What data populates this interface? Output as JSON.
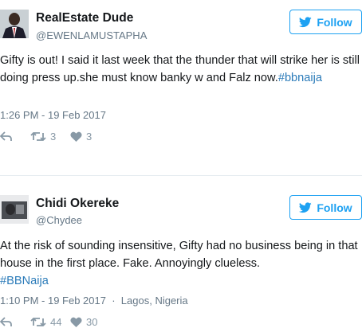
{
  "tweets": [
    {
      "name": "RealEstate Dude",
      "handle": "@EWENLAMUSTAPHA",
      "follow_label": "Follow",
      "text": "Gifty is out! I said it last week that the thunder that will strike her is still doing press up.she must know banky w and Falz now.",
      "hashtag": "#bbnaija",
      "time": "1:26 PM - 19 Feb 2017",
      "retweets": "3",
      "likes": "3"
    },
    {
      "name": "Chidi Okereke",
      "handle": "@Chydee",
      "follow_label": "Follow",
      "text": "At the risk of sounding insensitive, Gifty had no business being in that house in the first place. Fake. Annoyingly clueless.",
      "hashtag": "#BBNaija",
      "time": "1:10 PM - 19 Feb 2017",
      "location": "Lagos, Nigeria",
      "retweets": "44",
      "likes": "30"
    }
  ],
  "colors": {
    "twitter_blue": "#1da1f2",
    "link": "#2b7bb9",
    "muted": "#657786",
    "icon_gray": "#8899a6"
  }
}
